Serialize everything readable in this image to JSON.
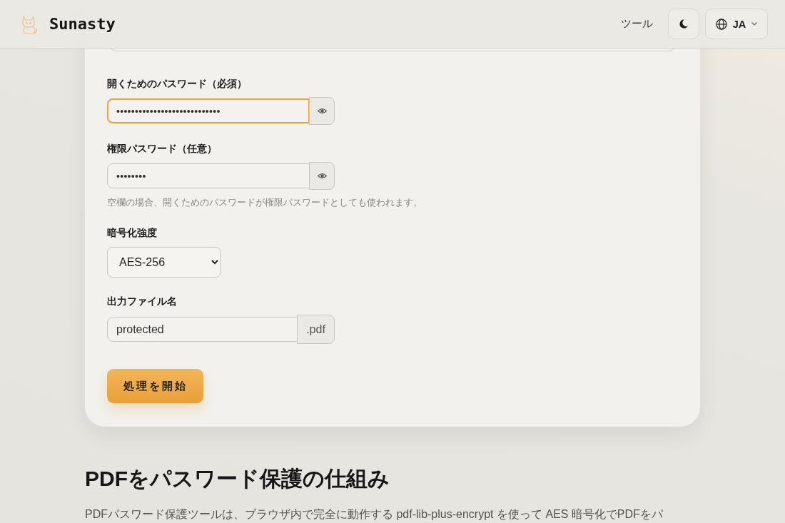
{
  "header": {
    "logo": "Sunasty",
    "nav": [
      {
        "label": "ツール"
      }
    ],
    "language": "JA"
  },
  "form": {
    "fields": [
      {
        "kind": "password",
        "label": "開くためのパスワード（必須）",
        "value": "••••••••••••••••••••••••••••",
        "focused": true
      },
      {
        "kind": "password",
        "label": "権限パスワード（任意）",
        "value": "••••••••",
        "focused": false,
        "hint": "空欄の場合、開くためのパスワードが権限パスワードとしても使われます。"
      },
      {
        "kind": "select",
        "label": "暗号化強度",
        "value": "AES-256",
        "focused": false
      },
      {
        "kind": "filename",
        "label": "出力ファイル名",
        "value": "protected",
        "suffix": ".pdf",
        "focused": false
      }
    ],
    "submit": "処理を開始"
  },
  "article": {
    "heading": "PDFをパスワード保護の仕組み",
    "paragraph": "PDFパスワード保護ツールは、ブラウザ内で完全に動作する pdf-lib-plus-encrypt を使って AES 暗号化でPDFをパ"
  }
}
